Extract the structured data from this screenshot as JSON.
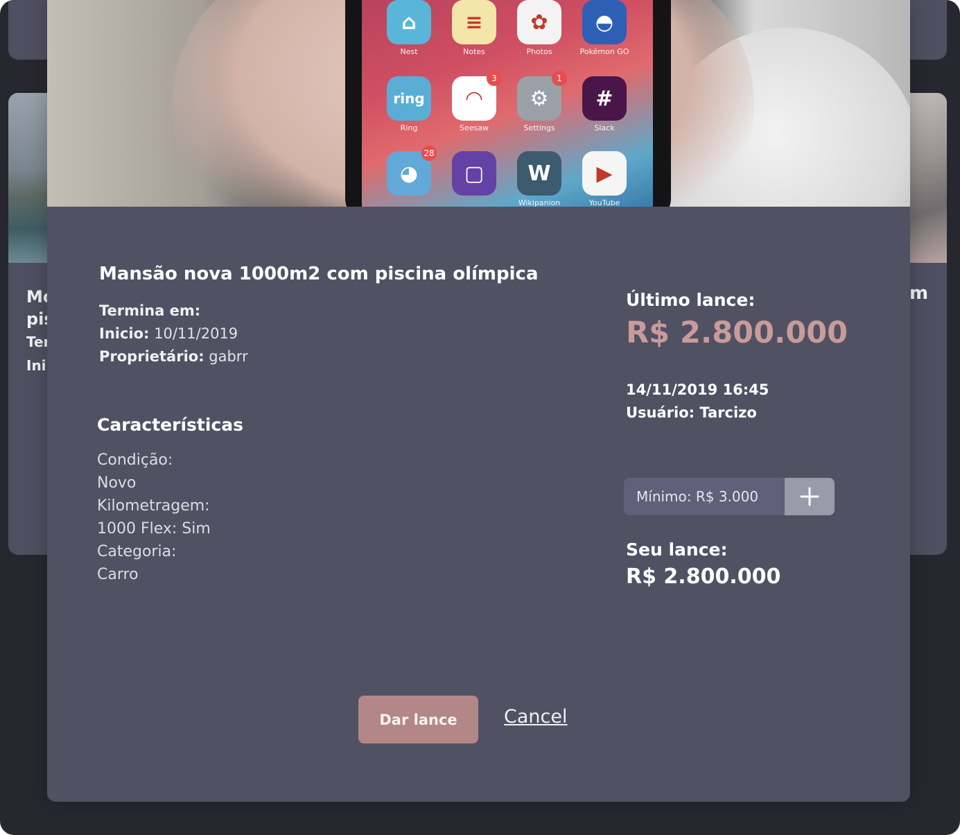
{
  "background_cards": {
    "left": {
      "title_lines": [
        "Mo",
        "pis"
      ],
      "field_lines": [
        "Ter",
        "Ini"
      ]
    },
    "right": {
      "title_fragment": "m"
    }
  },
  "hero": {
    "apps": [
      {
        "name": "Nest",
        "icon": "home-icon",
        "glyph": "⌂",
        "color": "#59b6d9",
        "badge": ""
      },
      {
        "name": "Notes",
        "icon": "notes-icon",
        "glyph": "≡",
        "color": "#f4e6a8",
        "badge": ""
      },
      {
        "name": "Photos",
        "icon": "photos-icon",
        "glyph": "✿",
        "color": "#f3f3f3",
        "badge": ""
      },
      {
        "name": "Pokémon GO",
        "icon": "pokeball-icon",
        "glyph": "◓",
        "color": "#2d5fb5",
        "badge": ""
      },
      {
        "name": "Ring",
        "icon": "ring-icon",
        "glyph": "ring",
        "color": "#5aaed6",
        "badge": ""
      },
      {
        "name": "Seesaw",
        "icon": "seesaw-icon",
        "glyph": "◠",
        "color": "#ffffff",
        "badge": "3"
      },
      {
        "name": "Settings",
        "icon": "settings-icon",
        "glyph": "⚙",
        "color": "#9aa0a8",
        "badge": "1"
      },
      {
        "name": "Slack",
        "icon": "slack-icon",
        "glyph": "#",
        "color": "#4a164a",
        "badge": ""
      },
      {
        "name": "",
        "icon": "bird-app-icon",
        "glyph": "◕",
        "color": "#62a8d8",
        "badge": "28"
      },
      {
        "name": "",
        "icon": "twitch-icon",
        "glyph": "▢",
        "color": "#6441a5",
        "badge": ""
      },
      {
        "name": "Wikipanion",
        "icon": "wikipanion-icon",
        "glyph": "W",
        "color": "#3d5b6e",
        "badge": ""
      },
      {
        "name": "YouTube",
        "icon": "youtube-icon",
        "glyph": "▶",
        "color": "#f5f5f5",
        "badge": ""
      }
    ]
  },
  "item": {
    "title": "Mansão nova 1000m2 com piscina olímpica",
    "ends_label": "Termina em:",
    "start_label": "Inicio:",
    "start_value": "10/11/2019",
    "owner_label": "Proprietário:",
    "owner_value": "gabrr"
  },
  "features": {
    "title": "Características",
    "lines": [
      "Condição:",
      "Novo",
      "Kilometragem:",
      "1000 Flex: Sim",
      "Categoria:",
      "Carro"
    ]
  },
  "bid": {
    "last_label": "Último lance:",
    "last_value": "R$ 2.800.000",
    "last_datetime": "14/11/2019 16:45",
    "user_line": "Usuário: Tarcizo",
    "minimum_text": "Mínimo: R$ 3.000",
    "your_label": "Seu lance:",
    "your_value": "R$ 2.800.000"
  },
  "actions": {
    "submit_label": "Dar lance",
    "cancel_label": "Cancel"
  },
  "colors": {
    "page_background": "#27272f",
    "modal_background": "#515164",
    "accent_price": "#c99b9b",
    "submit_button": "#b38787"
  }
}
